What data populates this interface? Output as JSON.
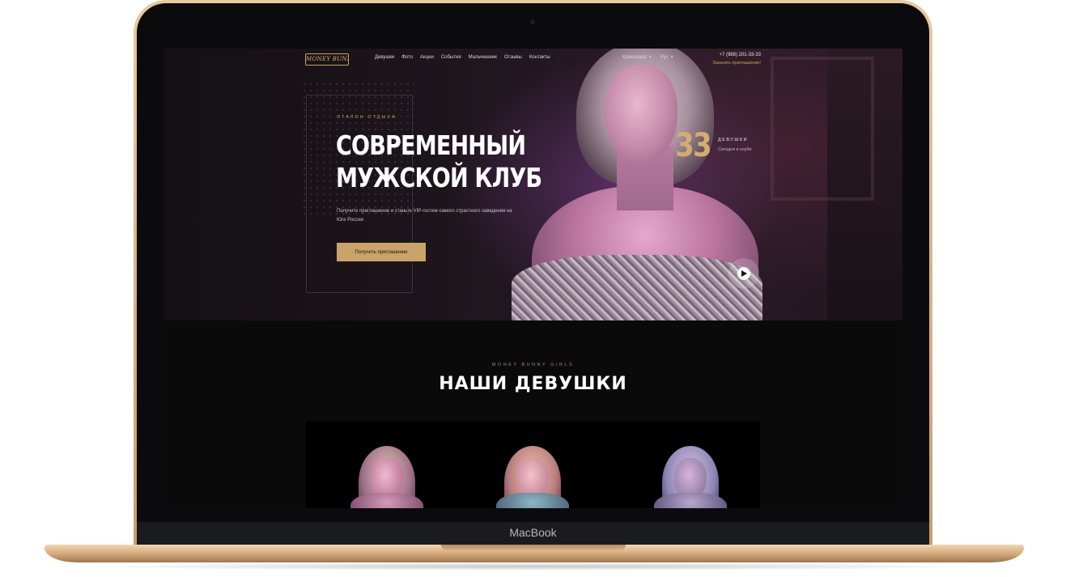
{
  "device": {
    "label": "MacBook"
  },
  "site": {
    "logo_text": "MONEY BUNNY",
    "nav": [
      "Девушки",
      "Фото",
      "Акции",
      "События",
      "Мальчишник",
      "Отзывы",
      "Контакты"
    ],
    "city": "Краснодар",
    "language": "Рус",
    "phone": "+7 (988) 201-33-33",
    "invite_link": "Заказать приглашение!"
  },
  "hero": {
    "eyebrow": "ЭТАЛОН ОТДЫХА",
    "headline_line1": "СОВРЕМЕННЫЙ",
    "headline_line2": "МУЖСКОЙ КЛУБ",
    "description": "Получите приглашение и станьте VIP-гостем самого страстного заведения на Юге России",
    "cta_label": "Получить приглашение",
    "counter": {
      "value": "33",
      "label": "ДЕВУШКИ",
      "sub": "Сегодня в клубе"
    }
  },
  "girls_section": {
    "eyebrow": "MONEY BUNNY GIRLS",
    "title": "НАШИ ДЕВУШКИ"
  },
  "icons": {
    "camera": "camera-dot",
    "play": "play-icon",
    "dropdown": "chevron-down-icon"
  },
  "colors": {
    "accent_gold": "#c9a36a",
    "background": "#0a0a0b",
    "laptop_gold": "#d2a676"
  }
}
